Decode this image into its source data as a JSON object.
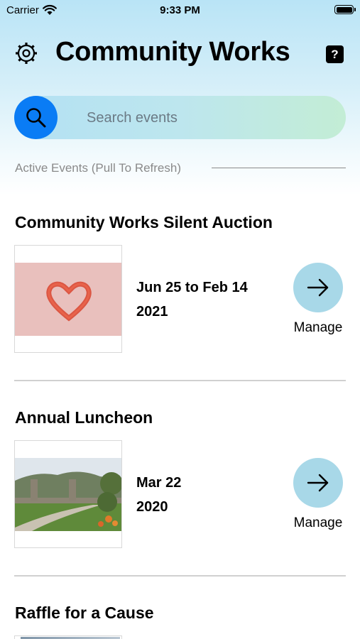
{
  "status_bar": {
    "carrier": "Carrier",
    "time": "9:33 PM"
  },
  "header": {
    "title": "Community Works",
    "help_label": "?"
  },
  "search": {
    "placeholder": "Search events"
  },
  "section": {
    "label": "Active Events (Pull To Refresh)"
  },
  "events": [
    {
      "title": "Community Works Silent Auction",
      "date_line1": "Jun 25 to Feb 14",
      "date_line2": "2021",
      "action": "Manage",
      "image": "heart-painting"
    },
    {
      "title": "Annual Luncheon",
      "date_line1": "Mar 22",
      "date_line2": "2020",
      "action": "Manage",
      "image": "bridge-landscape"
    },
    {
      "title": "Raffle for a Cause"
    }
  ],
  "colors": {
    "search_button": "#0a7cf5",
    "manage_button": "#a8d8e8",
    "header_gradient_top": "#b9e4f6"
  }
}
